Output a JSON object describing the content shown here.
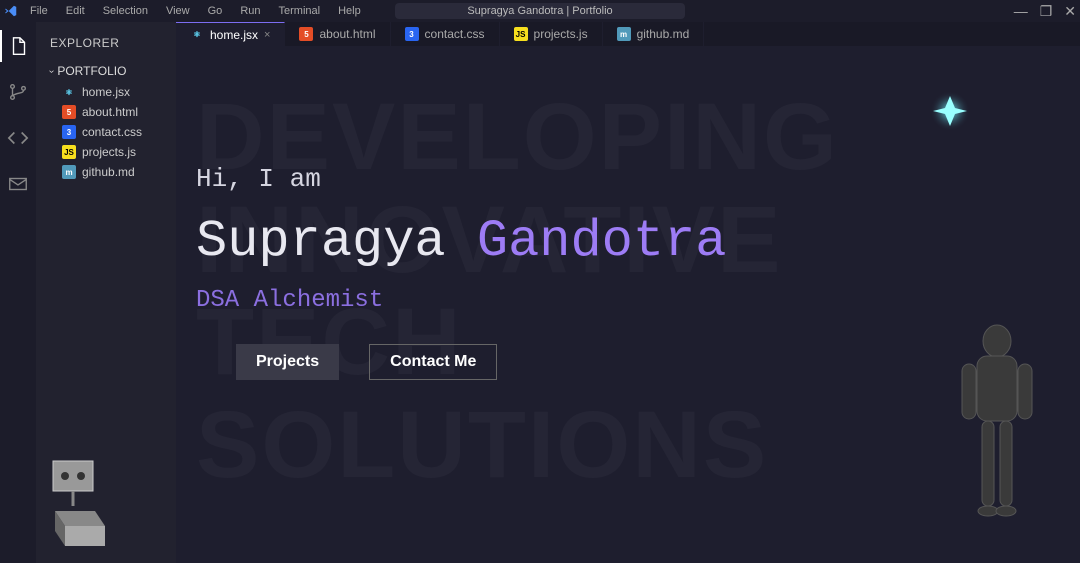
{
  "titlebar": {
    "title": "Supragya Gandotra | Portfolio",
    "menu": [
      "File",
      "Edit",
      "Selection",
      "View",
      "Go",
      "Run",
      "Terminal",
      "Help"
    ],
    "controls": {
      "minimize": "—",
      "maximize": "❐",
      "close": "✕"
    }
  },
  "activitybar": {
    "items": [
      {
        "name": "files-icon",
        "active": true
      },
      {
        "name": "git-branch-icon",
        "active": false
      },
      {
        "name": "code-icon",
        "active": false
      },
      {
        "name": "mail-icon",
        "active": false
      }
    ]
  },
  "sidebar": {
    "title": "EXPLORER",
    "section": "PORTFOLIO",
    "files": [
      {
        "label": "home.jsx",
        "icon": "react"
      },
      {
        "label": "about.html",
        "icon": "html"
      },
      {
        "label": "contact.css",
        "icon": "css"
      },
      {
        "label": "projects.js",
        "icon": "js"
      },
      {
        "label": "github.md",
        "icon": "md"
      }
    ]
  },
  "tabs": [
    {
      "label": "home.jsx",
      "icon": "react",
      "active": true,
      "close": "×"
    },
    {
      "label": "about.html",
      "icon": "html",
      "active": false
    },
    {
      "label": "contact.css",
      "icon": "css",
      "active": false
    },
    {
      "label": "projects.js",
      "icon": "js",
      "active": false
    },
    {
      "label": "github.md",
      "icon": "md",
      "active": false
    }
  ],
  "hero": {
    "hi": "Hi, I am",
    "first_name": "Supragya",
    "last_name": "Gandotra",
    "role": "DSA Alchemist",
    "btn_projects": "Projects",
    "btn_contact": "Contact Me"
  },
  "background_words": {
    "l1": "DEVELOPING",
    "l2": "INNOVATIVE",
    "l3": "TECH",
    "l4": "SOLUTIONS"
  },
  "colors": {
    "accent_purple": "#9d7cf5",
    "background": "#1e1e2e",
    "panel": "#22222f"
  }
}
